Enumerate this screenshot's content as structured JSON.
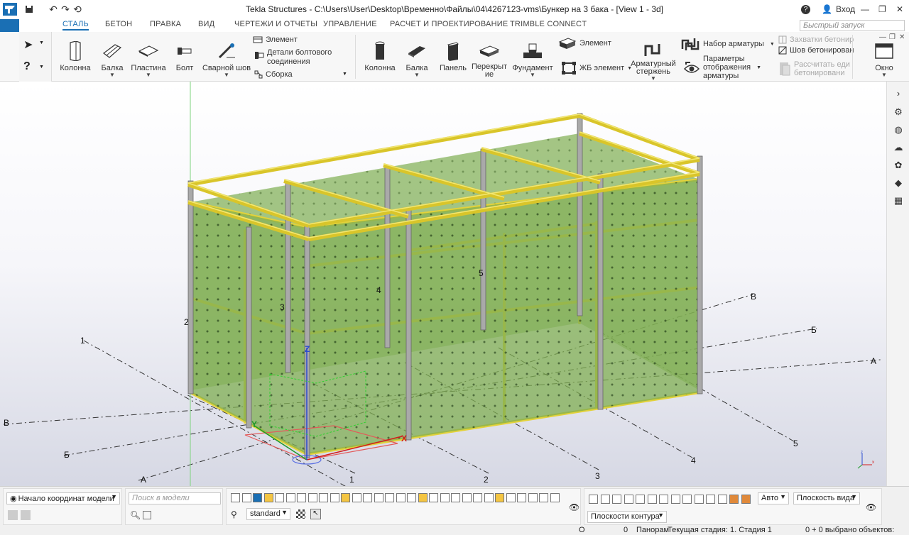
{
  "window": {
    "title": "Tekla Structures - C:\\Users\\User\\Desktop\\Временно\\Файлы\\04\\4267123-vms\\Бункер на 3 бака  - [View 1 - 3d]",
    "login_label": "Вход",
    "help_label": "?"
  },
  "tabs": [
    {
      "label": "СТАЛЬ",
      "active": true
    },
    {
      "label": "БЕТОН"
    },
    {
      "label": "ПРАВКА"
    },
    {
      "label": "ВИД"
    },
    {
      "label": "ЧЕРТЕЖИ И ОТЧЕТЫ"
    },
    {
      "label": "УПРАВЛЕНИЕ"
    },
    {
      "label": "РАСЧЕТ И ПРОЕКТИРОВАНИЕ"
    },
    {
      "label": "TRIMBLE CONNECT"
    }
  ],
  "quick_launch": {
    "placeholder": "Быстрый запуск"
  },
  "steel": {
    "column": "Колонна",
    "beam": "Балка",
    "plate": "Пластина",
    "bolt": "Болт",
    "weld": "Сварной шов",
    "element": "Элемент",
    "bolt_details_1": "Детали болтового",
    "bolt_details_2": "соединения",
    "assembly": "Сборка"
  },
  "concrete": {
    "column": "Колонна",
    "beam": "Балка",
    "panel": "Панель",
    "slab_1": "Перекрыт",
    "slab_2": "ие",
    "footing": "Фундамент",
    "element": "Элемент",
    "rc_element": "ЖБ элемент",
    "rebar_1": "Арматурный",
    "rebar_2": "стержень",
    "rebar_set": "Набор арматуры",
    "rebar_display_1": "Параметры",
    "rebar_display_2": "отображения",
    "rebar_display_3": "арматуры",
    "pour_breaks": "Захватки бетонир",
    "pour_joint": "Шов бетонирован",
    "calc_pour_1": "Рассчитать еди",
    "calc_pour_2": "бетонировани",
    "window": "Окно"
  },
  "viewport": {
    "grid_labels": {
      "n1_left": "1",
      "n1_bottom": "1",
      "n2_bottom": "2",
      "n3_bottom": "3",
      "n4_bottom": "4",
      "n5_bottom": "5",
      "v_left": "В",
      "b_left": "Б",
      "a_left": "А",
      "v_right": "В",
      "b_right": "Б",
      "a_right": "А",
      "p2": "2",
      "p3": "3",
      "p4": "4",
      "p5": "5"
    },
    "axis": {
      "x": "X",
      "y": "Y",
      "z": "Z"
    },
    "colors": {
      "panel": "#7fae52",
      "frame": "#e3d23a",
      "column": "#a9a9a9",
      "grid": "#333333"
    }
  },
  "bottom": {
    "origin_combo": "Начало координат модели",
    "search_placeholder": "Поиск в модели",
    "filter_combo": "standard",
    "auto_combo": "Авто",
    "plane_combo": "Плоскость вида",
    "contour_combo": "Плоскости контура"
  },
  "status": {
    "o_label": "O",
    "zero": "0",
    "panorama": "Панорам",
    "stage": "Текущая стадия: 1. Стадия 1",
    "selected": "0 + 0 выбрано объектов:"
  }
}
